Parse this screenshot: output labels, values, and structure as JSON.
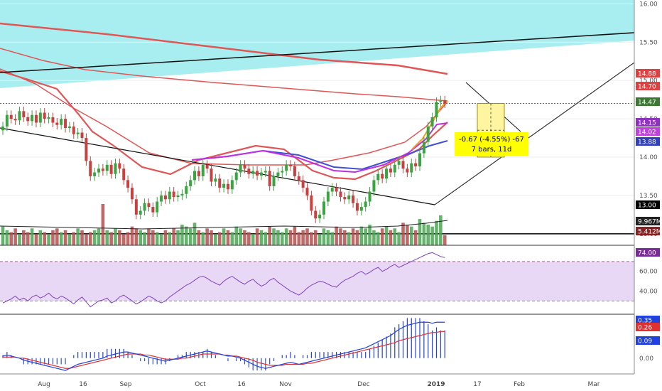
{
  "colors": {
    "background": "#ffffff",
    "cyan_zone": "#a8eef0",
    "rsi_band": "#e8d8f6",
    "up_candle": "#3aa540",
    "down_candle": "#c94040",
    "vol_up": "#4aa654",
    "vol_down": "#b54f4f",
    "ma_long": "#e05656",
    "ma_fast_orange": "#f0a020",
    "ma_fast_magenta": "#c030e0",
    "ma_blue": "#4050d0",
    "rsi_line": "#8040c0",
    "macd_line": "#2040e0",
    "signal_line": "#e03030",
    "measure_box": "#fff5a0",
    "label_yellow": "#ffff00"
  },
  "chart_data": [
    {
      "type": "candlestick",
      "panel": "price",
      "y_ticks": [
        "16.00",
        "15.50",
        "15.00",
        "14.50",
        "14.00",
        "13.50",
        "13.00"
      ],
      "ylim": [
        12.85,
        16.05
      ],
      "x_ticks": [
        "Aug",
        "16",
        "Sep",
        "Oct",
        "16",
        "Nov",
        "Dec",
        "2019",
        "17",
        "Feb",
        "Mar"
      ],
      "price_tags": [
        {
          "value": 14.88,
          "label": "14.88",
          "color": "#e04040"
        },
        {
          "value": 14.7,
          "label": "14.70",
          "color": "#e04040"
        },
        {
          "value": 14.47,
          "label": "14.47",
          "color": "#3a7a30"
        },
        {
          "value": 14.15,
          "label": "14.15",
          "color": "#9030c0"
        },
        {
          "value": 14.02,
          "label": "14.02",
          "color": "#c040e0"
        },
        {
          "value": 13.88,
          "label": "13.88",
          "color": "#3040c0"
        },
        {
          "value": 13.0,
          "label": "13.00",
          "color": "#000000"
        }
      ],
      "closes": [
        14.4,
        14.55,
        14.5,
        14.48,
        14.6,
        14.52,
        14.47,
        14.55,
        14.45,
        14.58,
        14.5,
        14.52,
        14.45,
        14.42,
        14.5,
        14.38,
        14.4,
        14.3,
        14.32,
        14.25,
        13.95,
        13.75,
        13.8,
        13.85,
        13.82,
        13.9,
        13.78,
        13.92,
        13.85,
        13.7,
        13.6,
        13.45,
        13.25,
        13.3,
        13.4,
        13.35,
        13.28,
        13.42,
        13.5,
        13.45,
        13.55,
        13.48,
        13.5,
        13.52,
        13.62,
        13.7,
        13.82,
        13.75,
        13.9,
        13.85,
        13.68,
        13.72,
        13.6,
        13.65,
        13.58,
        13.7,
        13.8,
        13.9,
        13.85,
        13.78,
        13.82,
        13.76,
        13.8,
        13.82,
        13.62,
        13.75,
        13.8,
        13.82,
        13.9,
        13.88,
        13.75,
        13.7,
        13.6,
        13.5,
        13.3,
        13.2,
        13.25,
        13.42,
        13.55,
        13.6,
        13.55,
        13.48,
        13.45,
        13.5,
        13.4,
        13.3,
        13.35,
        13.42,
        13.55,
        13.7,
        13.78,
        13.72,
        13.85,
        13.8,
        13.9,
        13.95,
        13.85,
        13.8,
        13.92,
        13.88,
        14.05,
        14.2,
        14.4,
        14.52,
        14.72,
        14.74,
        14.7
      ],
      "measure": {
        "change": "-0.67 (-4.55%) -67",
        "bars": "7 bars, 11d"
      }
    },
    {
      "type": "bar",
      "panel": "volume",
      "labels": [
        "9.967M",
        "5.412M"
      ],
      "values": [
        10,
        8,
        7,
        9,
        6,
        8,
        7,
        9,
        6,
        8,
        7,
        6,
        8,
        9,
        7,
        8,
        6,
        7,
        9,
        8,
        6,
        7,
        8,
        9,
        22,
        8,
        7,
        9,
        8,
        6,
        7,
        10,
        9,
        8,
        7,
        9,
        8,
        7,
        6,
        8,
        7,
        9,
        8,
        11,
        10,
        9,
        12,
        8,
        7,
        9,
        8,
        6,
        7,
        9,
        8,
        7,
        10,
        9,
        8,
        7,
        6,
        9,
        8,
        7,
        10,
        9,
        8,
        7,
        9,
        8,
        10,
        7,
        8,
        9,
        7,
        8,
        6,
        9,
        8,
        7,
        10,
        9,
        8,
        7,
        9,
        8,
        10,
        9,
        11,
        8,
        7,
        9,
        10,
        8,
        9,
        7,
        12,
        11,
        10,
        8,
        14,
        12,
        11,
        10,
        13,
        16,
        5.4
      ]
    },
    {
      "type": "line",
      "panel": "rsi",
      "y_ticks": [
        "60.00",
        "40.00"
      ],
      "ylim": [
        18,
        85
      ],
      "tag": "74.00",
      "values": [
        28,
        30,
        32,
        35,
        31,
        33,
        30,
        34,
        36,
        33,
        35,
        38,
        34,
        32,
        35,
        33,
        30,
        27,
        31,
        34,
        29,
        24,
        27,
        30,
        31,
        33,
        28,
        30,
        34,
        36,
        33,
        30,
        27,
        29,
        32,
        35,
        33,
        30,
        28,
        30,
        34,
        37,
        40,
        43,
        46,
        48,
        51,
        54,
        55,
        53,
        50,
        48,
        46,
        50,
        53,
        55,
        52,
        49,
        47,
        50,
        52,
        48,
        45,
        47,
        51,
        53,
        49,
        46,
        43,
        40,
        38,
        36,
        39,
        43,
        46,
        48,
        50,
        49,
        47,
        45,
        44,
        48,
        51,
        53,
        55,
        58,
        60,
        57,
        59,
        62,
        64,
        60,
        62,
        65,
        67,
        64,
        66,
        68,
        70,
        72,
        74,
        76,
        78,
        79,
        77,
        75,
        74
      ]
    },
    {
      "type": "line",
      "panel": "macd",
      "y_ticks": [
        "0.00"
      ],
      "tags": [
        "0.35",
        "0.26",
        "0.09"
      ],
      "macd": [
        0.02,
        0.03,
        0.02,
        0.01,
        0.0,
        -0.02,
        -0.03,
        -0.04,
        -0.05,
        -0.06,
        -0.07,
        -0.08,
        -0.09,
        -0.1,
        -0.11,
        -0.12,
        -0.1,
        -0.08,
        -0.06,
        -0.05,
        -0.04,
        -0.03,
        -0.02,
        -0.01,
        0.0,
        0.02,
        0.03,
        0.04,
        0.05,
        0.06,
        0.06,
        0.05,
        0.04,
        0.03,
        0.02,
        0.01,
        0.0,
        -0.01,
        -0.02,
        -0.03,
        -0.02,
        -0.01,
        0.0,
        0.01,
        0.02,
        0.03,
        0.04,
        0.05,
        0.06,
        0.07,
        0.06,
        0.05,
        0.04,
        0.03,
        0.02,
        0.02,
        0.01,
        0.0,
        -0.02,
        -0.04,
        -0.06,
        -0.08,
        -0.09,
        -0.1,
        -0.09,
        -0.08,
        -0.07,
        -0.06,
        -0.05,
        -0.04,
        -0.05,
        -0.06,
        -0.05,
        -0.04,
        -0.03,
        -0.02,
        -0.01,
        0.0,
        0.01,
        0.02,
        0.03,
        0.04,
        0.05,
        0.06,
        0.07,
        0.08,
        0.09,
        0.1,
        0.12,
        0.14,
        0.16,
        0.18,
        0.2,
        0.22,
        0.25,
        0.28,
        0.3,
        0.32,
        0.33,
        0.34,
        0.35,
        0.35,
        0.35,
        0.34,
        0.35,
        0.35,
        0.35
      ],
      "signal": [
        0.01,
        0.01,
        0.01,
        0.01,
        0.0,
        0.0,
        -0.01,
        -0.02,
        -0.03,
        -0.04,
        -0.05,
        -0.06,
        -0.07,
        -0.08,
        -0.09,
        -0.1,
        -0.1,
        -0.09,
        -0.08,
        -0.07,
        -0.06,
        -0.05,
        -0.04,
        -0.03,
        -0.02,
        -0.01,
        0.0,
        0.01,
        0.02,
        0.03,
        0.04,
        0.04,
        0.04,
        0.04,
        0.03,
        0.03,
        0.02,
        0.01,
        0.0,
        -0.01,
        -0.01,
        -0.01,
        -0.01,
        0.0,
        0.0,
        0.01,
        0.02,
        0.03,
        0.04,
        0.04,
        0.04,
        0.04,
        0.04,
        0.03,
        0.03,
        0.02,
        0.02,
        0.01,
        0.0,
        -0.01,
        -0.02,
        -0.04,
        -0.05,
        -0.06,
        -0.07,
        -0.07,
        -0.07,
        -0.07,
        -0.06,
        -0.06,
        -0.06,
        -0.06,
        -0.06,
        -0.05,
        -0.05,
        -0.04,
        -0.03,
        -0.02,
        -0.01,
        0.0,
        0.01,
        0.02,
        0.03,
        0.04,
        0.05,
        0.06,
        0.07,
        0.08,
        0.09,
        0.1,
        0.11,
        0.12,
        0.13,
        0.14,
        0.15,
        0.17,
        0.18,
        0.19,
        0.2,
        0.21,
        0.22,
        0.23,
        0.24,
        0.25,
        0.25,
        0.26,
        0.26
      ],
      "ylim": [
        -0.14,
        0.4
      ]
    }
  ]
}
